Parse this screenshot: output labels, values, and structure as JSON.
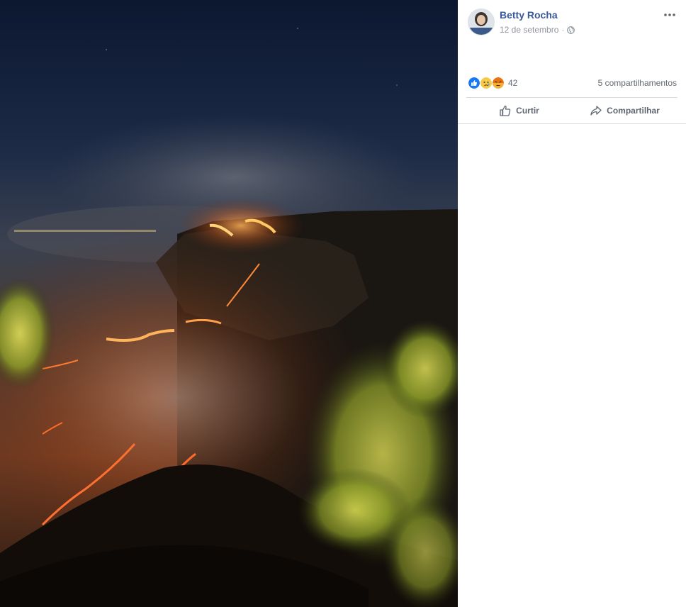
{
  "post": {
    "author": "Betty Rocha",
    "date": "12 de setembro",
    "date_separator": "·",
    "privacy_icon": "globe-icon",
    "more_icon": "more-options-icon"
  },
  "reactions": {
    "types": [
      "like-reaction-icon",
      "sad-reaction-icon",
      "angry-reaction-icon"
    ],
    "count": "42",
    "shares": "5 compartilhamentos"
  },
  "actions": {
    "like_label": "Curtir",
    "share_label": "Compartilhar"
  },
  "colors": {
    "link": "#385898",
    "secondary_text": "#90949c",
    "action_text": "#606770",
    "like_blue": "#1877f2",
    "reaction_yellow": "#f7c948",
    "angry_orange": "#e9710f"
  }
}
